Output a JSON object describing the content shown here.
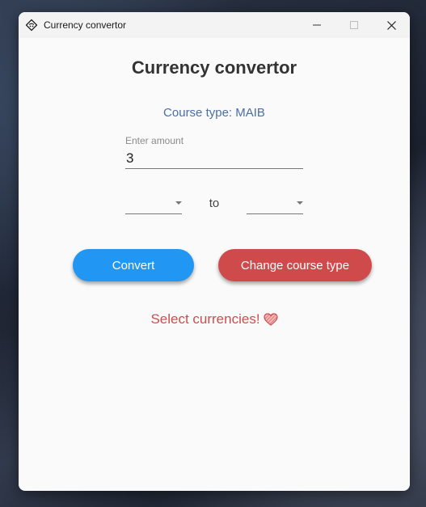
{
  "window": {
    "title": "Currency convertor"
  },
  "content": {
    "heading": "Currency convertor",
    "course_type": "Course type: MAIB",
    "amount": {
      "label": "Enter amount",
      "value": "3"
    },
    "from_currency": "",
    "to_label": "to",
    "to_currency": "",
    "convert_label": "Convert",
    "change_course_label": "Change course type",
    "message": "Select currencies!",
    "message_icon": "heart-icon"
  },
  "colors": {
    "convert_button": "#2196f3",
    "change_button": "#cf4b4b",
    "course_type_text": "#4a6fa5",
    "message_text": "#c94f4f"
  }
}
